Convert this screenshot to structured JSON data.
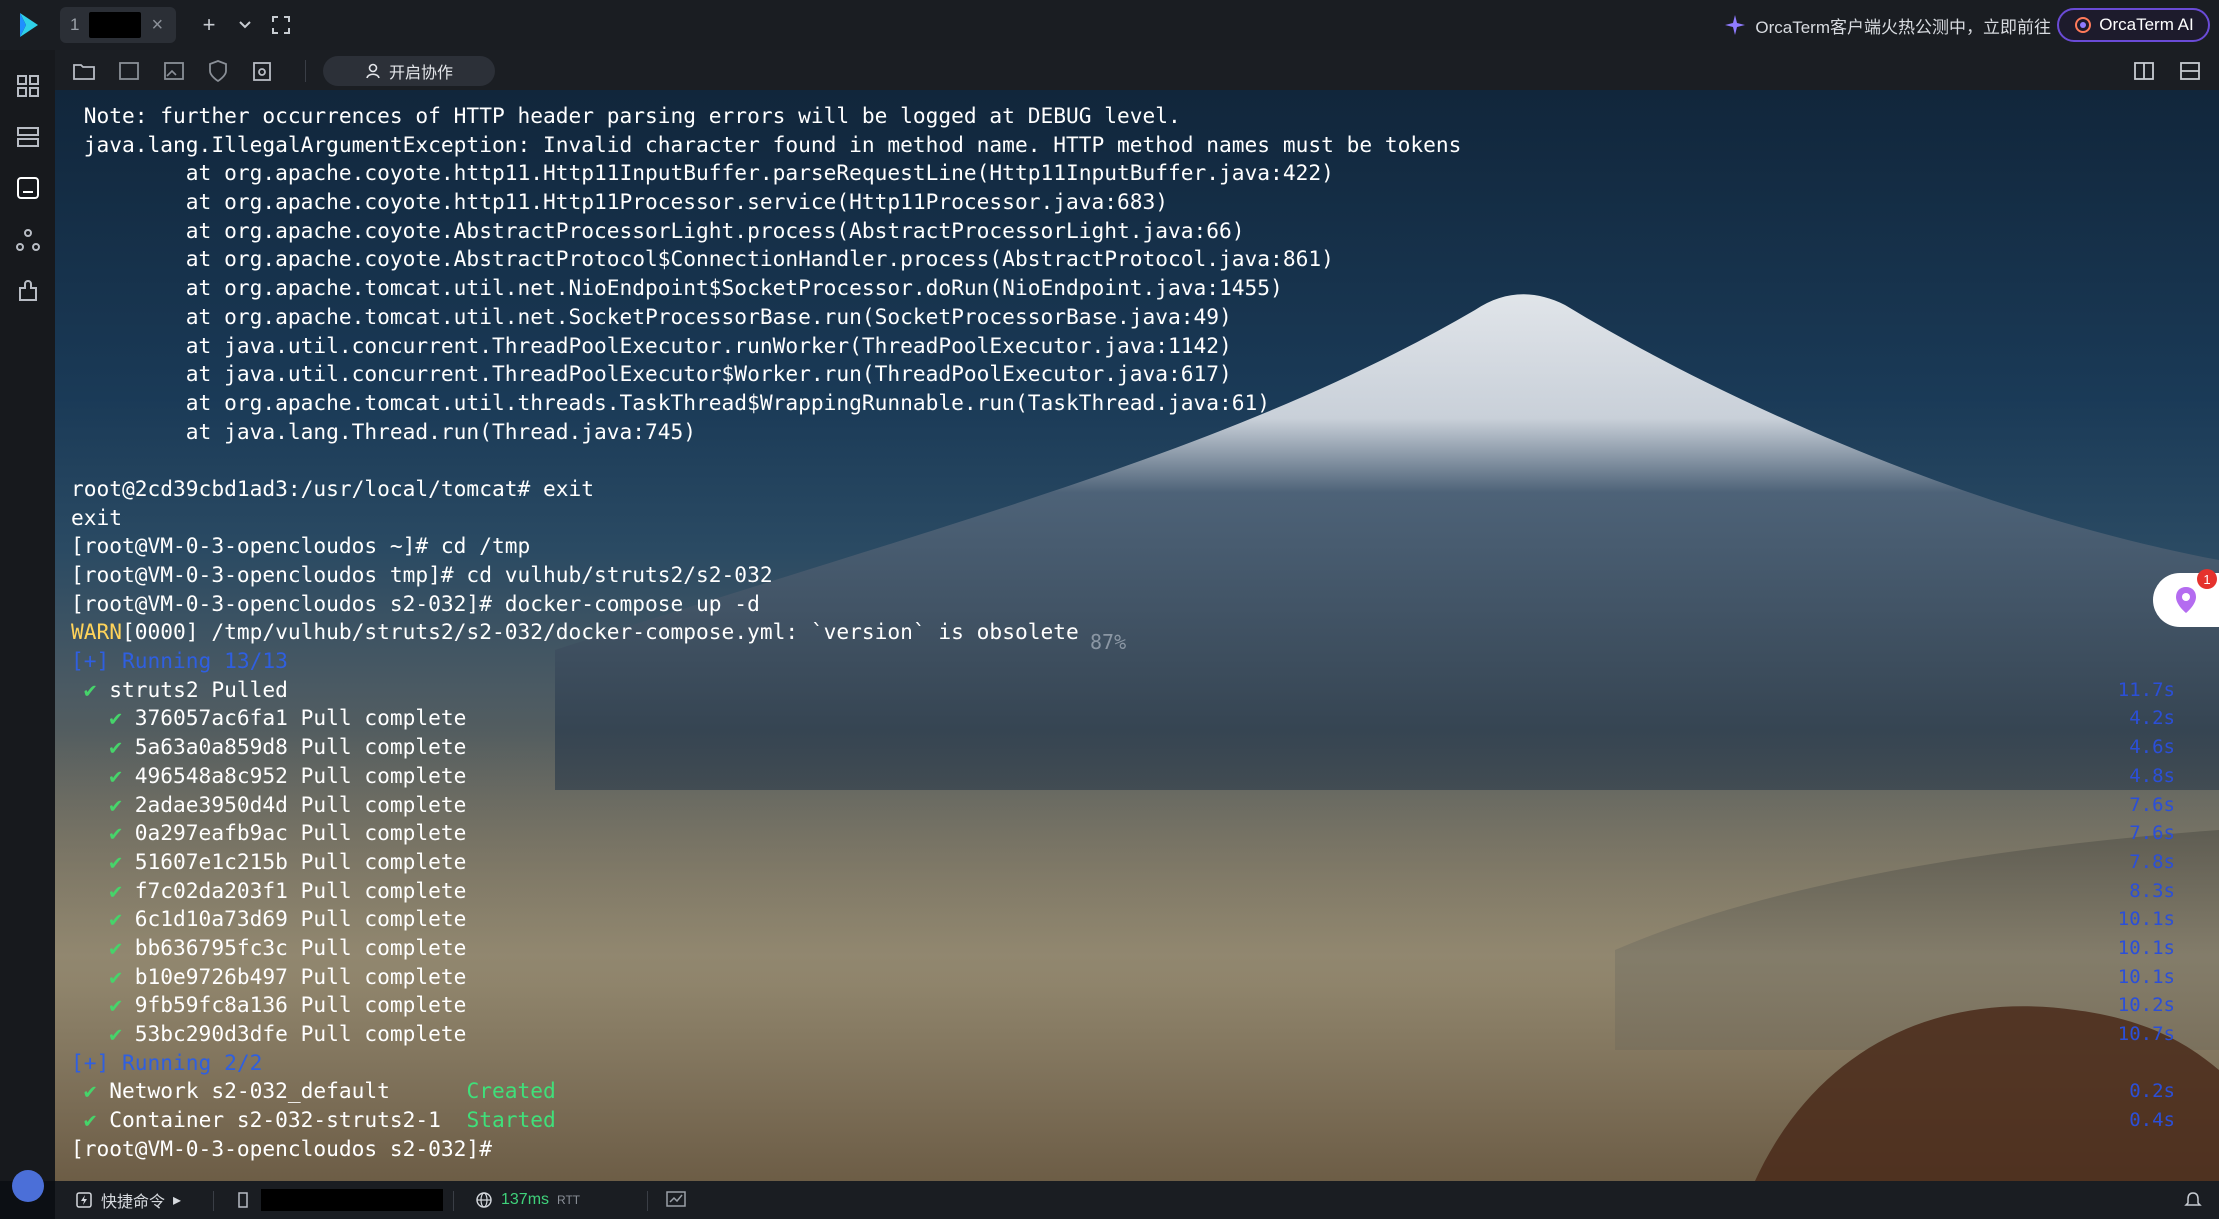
{
  "titlebar": {
    "tab_number": "1",
    "tab_close": "×",
    "add_tab": "+",
    "dropdown": "⌄",
    "fullscreen": "⛶",
    "promo_text": "OrcaTerm客户端火热公测中，立即前往",
    "ai_button": "OrcaTerm AI"
  },
  "toolbar": {
    "collab_label": "开启协作"
  },
  "terminal": {
    "lines": [
      {
        "text": "Note: further occurrences of HTTP header parsing errors will be logged at DEBUG level.",
        "indent": 1
      },
      {
        "text": "java.lang.IllegalArgumentException: Invalid character found in method name. HTTP method names must be tokens",
        "indent": 1
      },
      {
        "text": "        at org.apache.coyote.http11.Http11InputBuffer.parseRequestLine(Http11InputBuffer.java:422)",
        "indent": 1
      },
      {
        "text": "        at org.apache.coyote.http11.Http11Processor.service(Http11Processor.java:683)",
        "indent": 1
      },
      {
        "text": "        at org.apache.coyote.AbstractProcessorLight.process(AbstractProcessorLight.java:66)",
        "indent": 1
      },
      {
        "text": "        at org.apache.coyote.AbstractProtocol$ConnectionHandler.process(AbstractProtocol.java:861)",
        "indent": 1
      },
      {
        "text": "        at org.apache.tomcat.util.net.NioEndpoint$SocketProcessor.doRun(NioEndpoint.java:1455)",
        "indent": 1
      },
      {
        "text": "        at org.apache.tomcat.util.net.SocketProcessorBase.run(SocketProcessorBase.java:49)",
        "indent": 1
      },
      {
        "text": "        at java.util.concurrent.ThreadPoolExecutor.runWorker(ThreadPoolExecutor.java:1142)",
        "indent": 1
      },
      {
        "text": "        at java.util.concurrent.ThreadPoolExecutor$Worker.run(ThreadPoolExecutor.java:617)",
        "indent": 1
      },
      {
        "text": "        at org.apache.tomcat.util.threads.TaskThread$WrappingRunnable.run(TaskThread.java:61)",
        "indent": 1
      },
      {
        "text": "        at java.lang.Thread.run(Thread.java:745)",
        "indent": 1
      },
      {
        "text": "",
        "indent": 0
      },
      {
        "text": "root@2cd39cbd1ad3:/usr/local/tomcat# exit",
        "indent": 0
      },
      {
        "text": "exit",
        "indent": 0
      },
      {
        "text": "[root@VM-0-3-opencloudos ~]# cd /tmp",
        "indent": 0
      },
      {
        "text": "[root@VM-0-3-opencloudos tmp]# cd vulhub/struts2/s2-032",
        "indent": 0
      },
      {
        "text": "[root@VM-0-3-opencloudos s2-032]# docker-compose up -d",
        "indent": 0
      }
    ],
    "warn_prefix": "WARN",
    "warn_rest": "[0000] /tmp/vulhub/struts2/s2-032/docker-compose.yml: `version` is obsolete",
    "running1": "[+] Running 13/13",
    "pulled": " ✔ struts2 Pulled",
    "layers": [
      "376057ac6fa1 Pull complete",
      "5a63a0a859d8 Pull complete",
      "496548a8c952 Pull complete",
      "2adae3950d4d Pull complete",
      "0a297eafb9ac Pull complete",
      "51607e1c215b Pull complete",
      "f7c02da203f1 Pull complete",
      "6c1d10a73d69 Pull complete",
      "bb636795fc3c Pull complete",
      "b10e9726b497 Pull complete",
      "9fb59fc8a136 Pull complete",
      "53bc290d3dfe Pull complete"
    ],
    "running2": "[+] Running 2/2",
    "network_name": " ✔ Network s2-032_default",
    "network_status": "Created",
    "container_name": " ✔ Container s2-032-struts2-1",
    "container_status": "Started",
    "final_prompt": "[root@VM-0-3-opencloudos s2-032]#",
    "percent": "87%",
    "times": [
      "11.7s",
      "4.2s",
      "4.6s",
      "4.8s",
      "7.6s",
      "7.6s",
      "7.8s",
      "8.3s",
      "10.1s",
      "10.1s",
      "10.1s",
      "10.2s",
      "10.7s"
    ],
    "times2": [
      "0.2s",
      "0.4s"
    ],
    "badge_count": "1"
  },
  "statusbar": {
    "quick_commands": "快捷命令",
    "latency": "137ms",
    "rtt": "RTT"
  },
  "colors": {
    "accent": "#6a4bd6",
    "prompt_blue": "#2f5fe0",
    "warn": "#ffd35a",
    "ok": "#3fe07a"
  }
}
